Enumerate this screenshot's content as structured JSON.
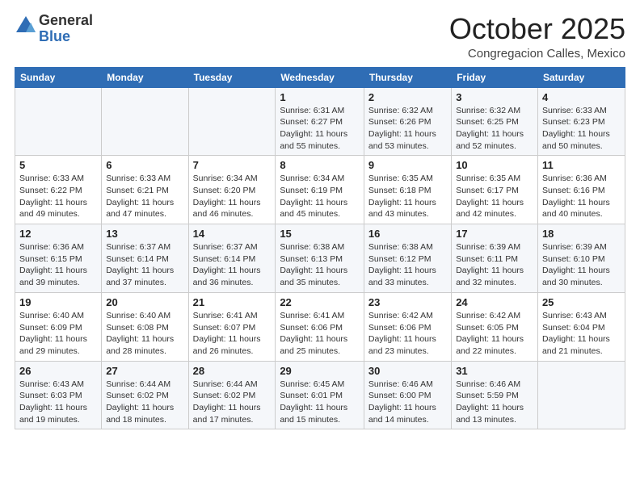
{
  "header": {
    "logo_general": "General",
    "logo_blue": "Blue",
    "month": "October 2025",
    "location": "Congregacion Calles, Mexico"
  },
  "weekdays": [
    "Sunday",
    "Monday",
    "Tuesday",
    "Wednesday",
    "Thursday",
    "Friday",
    "Saturday"
  ],
  "weeks": [
    [
      {
        "day": "",
        "info": ""
      },
      {
        "day": "",
        "info": ""
      },
      {
        "day": "",
        "info": ""
      },
      {
        "day": "1",
        "info": "Sunrise: 6:31 AM\nSunset: 6:27 PM\nDaylight: 11 hours\nand 55 minutes."
      },
      {
        "day": "2",
        "info": "Sunrise: 6:32 AM\nSunset: 6:26 PM\nDaylight: 11 hours\nand 53 minutes."
      },
      {
        "day": "3",
        "info": "Sunrise: 6:32 AM\nSunset: 6:25 PM\nDaylight: 11 hours\nand 52 minutes."
      },
      {
        "day": "4",
        "info": "Sunrise: 6:33 AM\nSunset: 6:23 PM\nDaylight: 11 hours\nand 50 minutes."
      }
    ],
    [
      {
        "day": "5",
        "info": "Sunrise: 6:33 AM\nSunset: 6:22 PM\nDaylight: 11 hours\nand 49 minutes."
      },
      {
        "day": "6",
        "info": "Sunrise: 6:33 AM\nSunset: 6:21 PM\nDaylight: 11 hours\nand 47 minutes."
      },
      {
        "day": "7",
        "info": "Sunrise: 6:34 AM\nSunset: 6:20 PM\nDaylight: 11 hours\nand 46 minutes."
      },
      {
        "day": "8",
        "info": "Sunrise: 6:34 AM\nSunset: 6:19 PM\nDaylight: 11 hours\nand 45 minutes."
      },
      {
        "day": "9",
        "info": "Sunrise: 6:35 AM\nSunset: 6:18 PM\nDaylight: 11 hours\nand 43 minutes."
      },
      {
        "day": "10",
        "info": "Sunrise: 6:35 AM\nSunset: 6:17 PM\nDaylight: 11 hours\nand 42 minutes."
      },
      {
        "day": "11",
        "info": "Sunrise: 6:36 AM\nSunset: 6:16 PM\nDaylight: 11 hours\nand 40 minutes."
      }
    ],
    [
      {
        "day": "12",
        "info": "Sunrise: 6:36 AM\nSunset: 6:15 PM\nDaylight: 11 hours\nand 39 minutes."
      },
      {
        "day": "13",
        "info": "Sunrise: 6:37 AM\nSunset: 6:14 PM\nDaylight: 11 hours\nand 37 minutes."
      },
      {
        "day": "14",
        "info": "Sunrise: 6:37 AM\nSunset: 6:14 PM\nDaylight: 11 hours\nand 36 minutes."
      },
      {
        "day": "15",
        "info": "Sunrise: 6:38 AM\nSunset: 6:13 PM\nDaylight: 11 hours\nand 35 minutes."
      },
      {
        "day": "16",
        "info": "Sunrise: 6:38 AM\nSunset: 6:12 PM\nDaylight: 11 hours\nand 33 minutes."
      },
      {
        "day": "17",
        "info": "Sunrise: 6:39 AM\nSunset: 6:11 PM\nDaylight: 11 hours\nand 32 minutes."
      },
      {
        "day": "18",
        "info": "Sunrise: 6:39 AM\nSunset: 6:10 PM\nDaylight: 11 hours\nand 30 minutes."
      }
    ],
    [
      {
        "day": "19",
        "info": "Sunrise: 6:40 AM\nSunset: 6:09 PM\nDaylight: 11 hours\nand 29 minutes."
      },
      {
        "day": "20",
        "info": "Sunrise: 6:40 AM\nSunset: 6:08 PM\nDaylight: 11 hours\nand 28 minutes."
      },
      {
        "day": "21",
        "info": "Sunrise: 6:41 AM\nSunset: 6:07 PM\nDaylight: 11 hours\nand 26 minutes."
      },
      {
        "day": "22",
        "info": "Sunrise: 6:41 AM\nSunset: 6:06 PM\nDaylight: 11 hours\nand 25 minutes."
      },
      {
        "day": "23",
        "info": "Sunrise: 6:42 AM\nSunset: 6:06 PM\nDaylight: 11 hours\nand 23 minutes."
      },
      {
        "day": "24",
        "info": "Sunrise: 6:42 AM\nSunset: 6:05 PM\nDaylight: 11 hours\nand 22 minutes."
      },
      {
        "day": "25",
        "info": "Sunrise: 6:43 AM\nSunset: 6:04 PM\nDaylight: 11 hours\nand 21 minutes."
      }
    ],
    [
      {
        "day": "26",
        "info": "Sunrise: 6:43 AM\nSunset: 6:03 PM\nDaylight: 11 hours\nand 19 minutes."
      },
      {
        "day": "27",
        "info": "Sunrise: 6:44 AM\nSunset: 6:02 PM\nDaylight: 11 hours\nand 18 minutes."
      },
      {
        "day": "28",
        "info": "Sunrise: 6:44 AM\nSunset: 6:02 PM\nDaylight: 11 hours\nand 17 minutes."
      },
      {
        "day": "29",
        "info": "Sunrise: 6:45 AM\nSunset: 6:01 PM\nDaylight: 11 hours\nand 15 minutes."
      },
      {
        "day": "30",
        "info": "Sunrise: 6:46 AM\nSunset: 6:00 PM\nDaylight: 11 hours\nand 14 minutes."
      },
      {
        "day": "31",
        "info": "Sunrise: 6:46 AM\nSunset: 5:59 PM\nDaylight: 11 hours\nand 13 minutes."
      },
      {
        "day": "",
        "info": ""
      }
    ]
  ]
}
